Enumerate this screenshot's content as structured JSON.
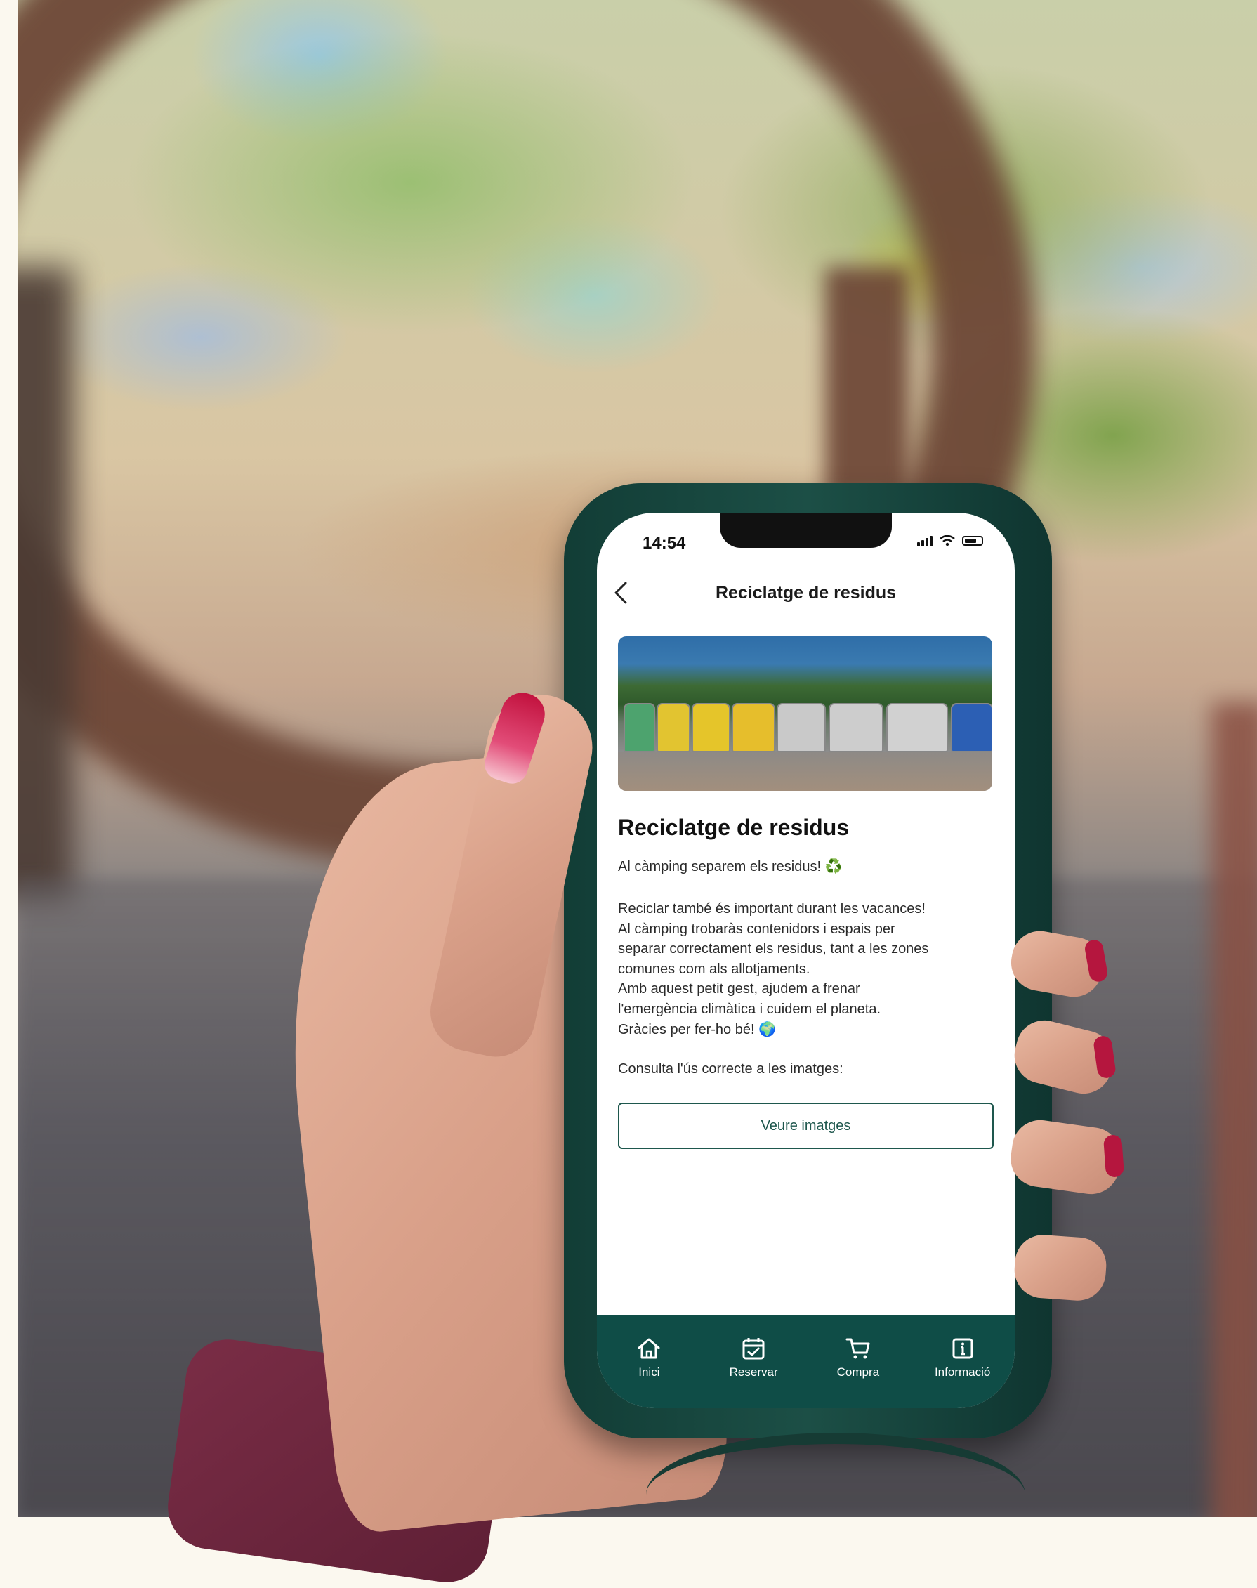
{
  "status_bar": {
    "time": "14:54"
  },
  "header": {
    "title": "Reciclatge de residus"
  },
  "article": {
    "title": "Reciclatge de residus",
    "intro": "Al càmping separem els residus!",
    "intro_emoji": "♻️",
    "body_lines": [
      "Reciclar també és important durant les vacances!",
      "Al càmping trobaràs contenidors i espais per",
      "separar correctament els residus, tant a les zones",
      "comunes com als allotjaments.",
      "Amb aquest petit gest, ajudem a frenar",
      "l'emergència climàtica i cuidem el planeta.",
      "Gràcies per fer-ho bé!"
    ],
    "outro_emoji": "🌍",
    "cta_text": "Consulta l'ús correcte a les imatges:",
    "button_label": "Veure imatges"
  },
  "tabbar": {
    "items": [
      {
        "label": "Inici",
        "icon": "home-icon"
      },
      {
        "label": "Reservar",
        "icon": "calendar-check-icon"
      },
      {
        "label": "Compra",
        "icon": "cart-icon"
      },
      {
        "label": "Informació",
        "icon": "info-icon"
      }
    ]
  },
  "colors": {
    "brand_green": "#0f4d47",
    "button_border": "#1e574d",
    "phone_case": "#1c4f46"
  }
}
